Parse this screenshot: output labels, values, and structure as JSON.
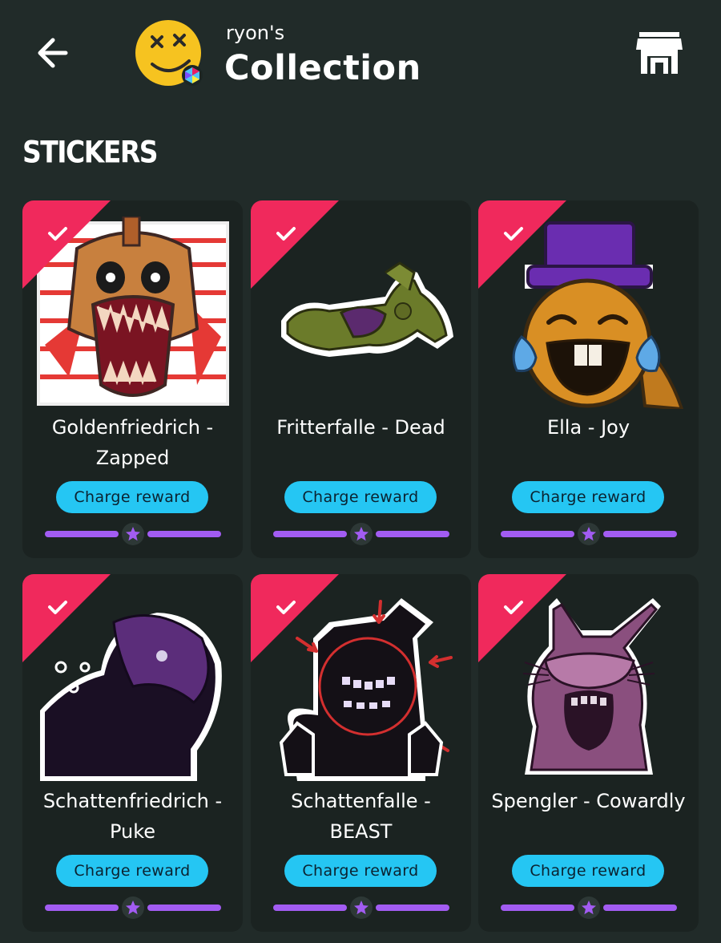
{
  "header": {
    "owner": "ryon's",
    "title": "Collection",
    "back_icon": "arrow-left-icon",
    "shop_icon": "storefront-icon",
    "avatar_icon": "dizzy-face-avatar"
  },
  "section": {
    "title": "STICKERS"
  },
  "colors": {
    "background": "#212b29",
    "card": "#1b2321",
    "ribbon": "#f0295c",
    "button": "#25c6f3",
    "progress": "#a25cf2"
  },
  "stickers": [
    {
      "name": "Goldenfriedrich - Zapped",
      "button_label": "Charge reward",
      "collected": true,
      "progress": 0.5
    },
    {
      "name": "Fritterfalle - Dead",
      "button_label": "Charge reward",
      "collected": true,
      "progress": 0.5
    },
    {
      "name": "Ella - Joy",
      "button_label": "Charge reward",
      "collected": true,
      "progress": 0.5
    },
    {
      "name": "Schattenfriedrich - Puke",
      "button_label": "Charge reward",
      "collected": true,
      "progress": 0.5
    },
    {
      "name": "Schattenfalle - BEAST",
      "button_label": "Charge reward",
      "collected": true,
      "progress": 0.5
    },
    {
      "name": "Spengler - Cowardly",
      "button_label": "Charge reward",
      "collected": true,
      "progress": 0.5
    }
  ]
}
